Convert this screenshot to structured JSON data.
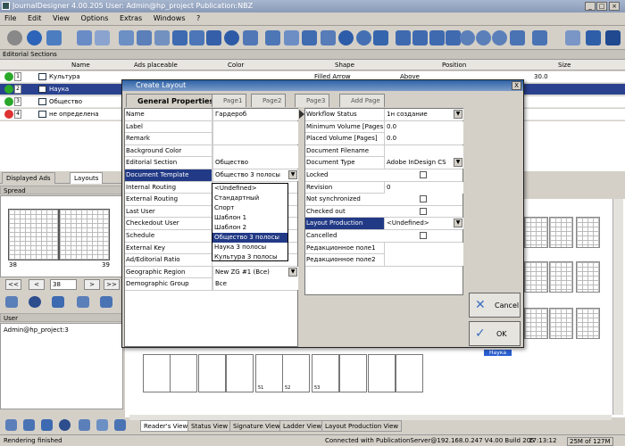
{
  "app": {
    "title": "JournalDesigner 4.00.205 User: Admin@hp_project Publication:NBZ"
  },
  "menu": [
    "File",
    "Edit",
    "View",
    "Options",
    "Extras",
    "Windows",
    "?"
  ],
  "editorial": {
    "title": "Editorial Sections",
    "columns": [
      "Name",
      "Ads placeable",
      "Color",
      "Shape",
      "Position",
      "Size"
    ],
    "rows": [
      {
        "num": "1",
        "name": "Культура",
        "shape": "Filled Arrow",
        "position": "Above",
        "size": "30.0",
        "status": "ok"
      },
      {
        "num": "2",
        "name": "Наука",
        "shape": "",
        "position": "",
        "size": "",
        "status": "ok"
      },
      {
        "num": "3",
        "name": "Общество",
        "shape": "",
        "position": "",
        "size": "",
        "status": "ok"
      },
      {
        "num": "4",
        "name": "не определена",
        "shape": "",
        "position": "",
        "size": "",
        "status": "bad"
      }
    ]
  },
  "left_tabs": [
    "Displayed Ads",
    "Layouts"
  ],
  "spread": {
    "title": "Spread",
    "left_page": "38",
    "right_page": "39",
    "nav_input": "38",
    "nav": {
      "first": "<<",
      "prev": "<",
      "next": ">",
      "last": ">>"
    }
  },
  "user": {
    "title": "User",
    "entry": "Admin@hp_project:3"
  },
  "bottom_tabs": [
    "Reader's View",
    "Status View",
    "Signature View",
    "Ladder View",
    "Layout Production View"
  ],
  "status": {
    "left": "Rendering finished",
    "connection": "Connected with PublicationServer@192.168.0.247 V4.00 Build 205",
    "time": "17:13:12",
    "memory": "25M of 127M"
  },
  "badge": "Наука",
  "page_numbers": [
    "",
    "",
    "",
    "",
    "51",
    "52",
    "53",
    "",
    "",
    ""
  ],
  "dialog": {
    "title": "Create Layout",
    "close": "X",
    "tabs": [
      "General Properties",
      "Page1",
      "Page2",
      "Page3",
      "Add Page"
    ],
    "left_props": [
      {
        "label": "Name",
        "value": "Гардероб"
      },
      {
        "label": "Label",
        "value": ""
      },
      {
        "label": "Remark",
        "value": ""
      },
      {
        "label": "Background Color",
        "value": ""
      },
      {
        "label": "Editorial Section",
        "value": "Общество"
      },
      {
        "label": "Document Template",
        "value": "Общество 3 полосы"
      },
      {
        "label": "Internal Routing",
        "value": ""
      },
      {
        "label": "External Routing",
        "value": ""
      },
      {
        "label": "Last User",
        "value": ""
      },
      {
        "label": "Checkedout User",
        "value": ""
      },
      {
        "label": "Schedule",
        "value": ""
      },
      {
        "label": "External Key",
        "value": ""
      },
      {
        "label": "Ad/Editorial Ratio",
        "value": ""
      },
      {
        "label": "Geographic Region",
        "value": "New ZG #1 (Все)"
      },
      {
        "label": "Demographic Group",
        "value": "Все"
      }
    ],
    "dropdown_options": [
      "<Undefined>",
      "Стандартный",
      "Спорт",
      "Шаблон 1",
      "Шаблон 2",
      "Общество 3 полосы",
      "Наука 3 полосы",
      "Культура 3 полосы"
    ],
    "right_props": [
      {
        "label": "Workflow Status",
        "value": "1н создание"
      },
      {
        "label": "Minimum Volume [Pages]",
        "value": "0.0"
      },
      {
        "label": "Placed Volume [Pages]",
        "value": "0.0"
      },
      {
        "label": "Document Filename",
        "value": ""
      },
      {
        "label": "Document Type",
        "value": "Adobe InDesign CS"
      },
      {
        "label": "Locked",
        "value": ""
      },
      {
        "label": "Revision",
        "value": "0"
      },
      {
        "label": "Not synchronized",
        "value": ""
      },
      {
        "label": "Checked out",
        "value": ""
      },
      {
        "label": "Layout Production",
        "value": "<Undefined>"
      },
      {
        "label": "Cancelled",
        "value": ""
      },
      {
        "label": "Редакционное поле1",
        "value": ""
      },
      {
        "label": "Редакционное поле2",
        "value": ""
      }
    ],
    "cancel": "Cancel",
    "ok": "OK"
  }
}
